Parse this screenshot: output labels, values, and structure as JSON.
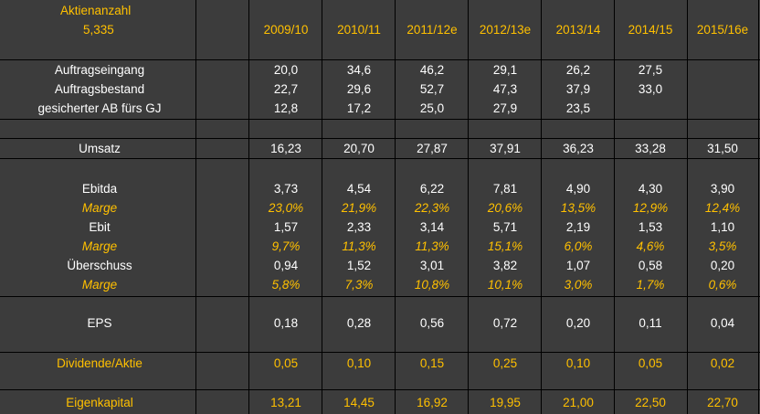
{
  "header": {
    "title": "Aktienanzahl",
    "shares": "5,335",
    "years": [
      "2009/10",
      "2010/11",
      "2011/12e",
      "2012/13e",
      "2013/14",
      "2014/15",
      "2015/16e"
    ]
  },
  "rows": [
    {
      "label": "Auftragseingang",
      "style": "white",
      "values": [
        "20,0",
        "34,6",
        "46,2",
        "29,1",
        "26,2",
        "27,5",
        ""
      ]
    },
    {
      "label": "Auftragsbestand",
      "style": "white",
      "values": [
        "22,7",
        "29,6",
        "52,7",
        "47,3",
        "37,9",
        "33,0",
        ""
      ]
    },
    {
      "label": "gesicherter AB fürs GJ",
      "style": "white",
      "values": [
        "12,8",
        "17,2",
        "25,0",
        "27,9",
        "23,5",
        "",
        ""
      ]
    },
    {
      "label": "Umsatz",
      "style": "white",
      "values": [
        "16,23",
        "20,70",
        "27,87",
        "37,91",
        "36,23",
        "33,28",
        "31,50"
      ]
    },
    {
      "label": "Ebitda",
      "style": "white",
      "values": [
        "3,73",
        "4,54",
        "6,22",
        "7,81",
        "4,90",
        "4,30",
        "3,90"
      ]
    },
    {
      "label": "Marge",
      "style": "gold-italic",
      "values": [
        "23,0%",
        "21,9%",
        "22,3%",
        "20,6%",
        "13,5%",
        "12,9%",
        "12,4%"
      ]
    },
    {
      "label": "Ebit",
      "style": "white",
      "values": [
        "1,57",
        "2,33",
        "3,14",
        "5,71",
        "2,19",
        "1,53",
        "1,10"
      ]
    },
    {
      "label": "Marge",
      "style": "gold-italic",
      "values": [
        "9,7%",
        "11,3%",
        "11,3%",
        "15,1%",
        "6,0%",
        "4,6%",
        "3,5%"
      ]
    },
    {
      "label": "Überschuss",
      "style": "white",
      "values": [
        "0,94",
        "1,52",
        "3,01",
        "3,82",
        "1,07",
        "0,58",
        "0,20"
      ]
    },
    {
      "label": "Marge",
      "style": "gold-italic",
      "values": [
        "5,8%",
        "7,3%",
        "10,8%",
        "10,1%",
        "3,0%",
        "1,7%",
        "0,6%"
      ]
    },
    {
      "label": "EPS",
      "style": "white",
      "values": [
        "0,18",
        "0,28",
        "0,56",
        "0,72",
        "0,20",
        "0,11",
        "0,04"
      ]
    },
    {
      "label": "Dividende/Aktie",
      "style": "gold",
      "values": [
        "0,05",
        "0,10",
        "0,15",
        "0,25",
        "0,10",
        "0,05",
        "0,02"
      ]
    },
    {
      "label": "Eigenkapital",
      "style": "gold",
      "values": [
        "13,21",
        "14,45",
        "16,92",
        "19,95",
        "21,00",
        "22,50",
        "22,70"
      ]
    }
  ],
  "colors": {
    "background": "#3c3c3c",
    "text": "#ffffff",
    "accent": "#ffc000",
    "grid": "#000000"
  }
}
